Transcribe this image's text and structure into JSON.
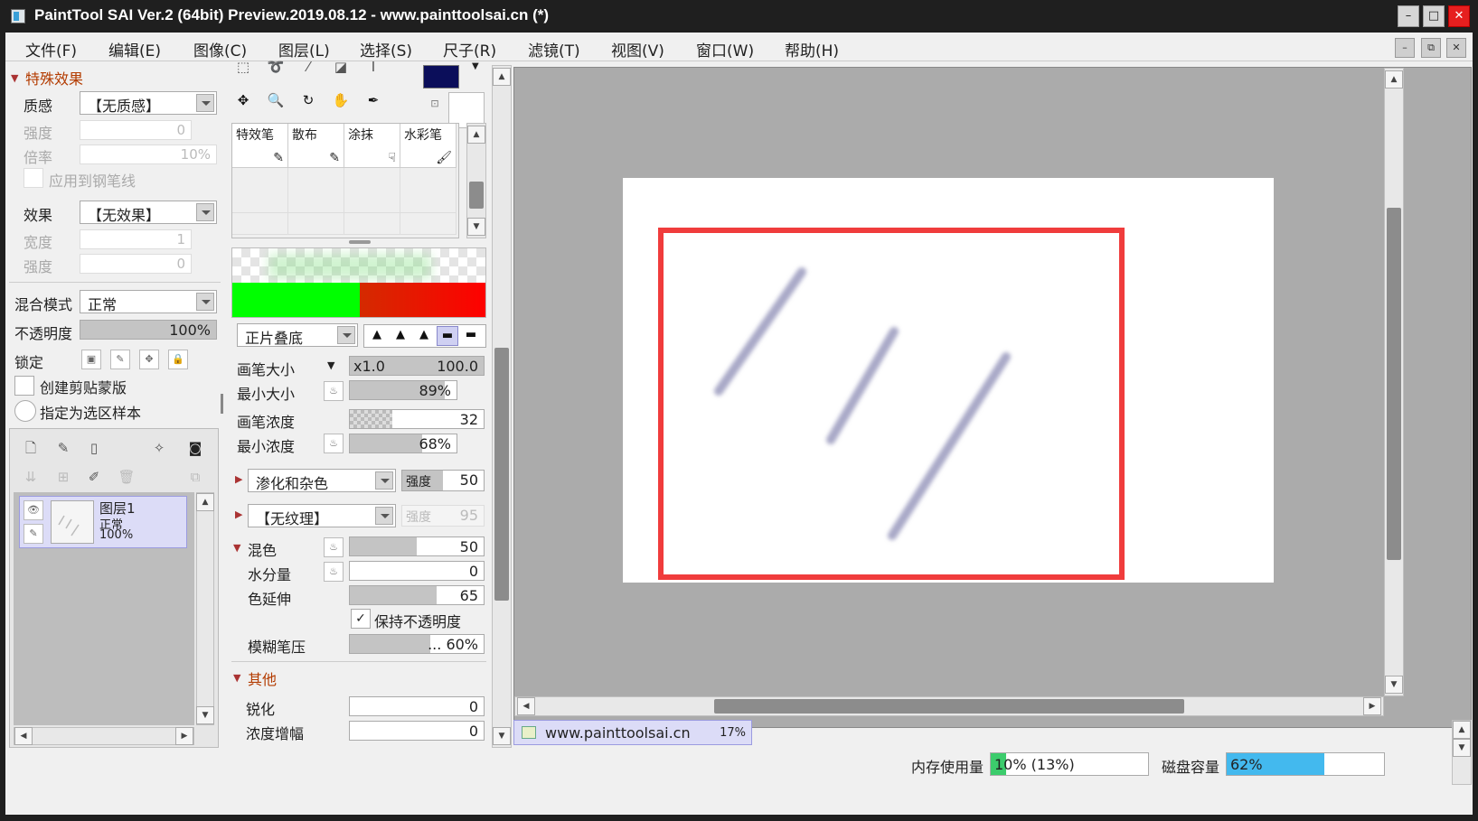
{
  "titlebar": {
    "title": "PaintTool SAI Ver.2 (64bit) Preview.2019.08.12 - www.painttoolsai.cn (*)",
    "minimize": "–",
    "maximize": "□",
    "close": "✕"
  },
  "menu": {
    "items": [
      "文件(F)",
      "编辑(E)",
      "图像(C)",
      "图层(L)",
      "选择(S)",
      "尺子(R)",
      "滤镜(T)",
      "视图(V)",
      "窗口(W)",
      "帮助(H)"
    ],
    "mdi_min": "–",
    "mdi_restore": "⧉",
    "mdi_close": "✕"
  },
  "effects": {
    "title": "特殊效果",
    "texture_label": "质感",
    "texture_value": "【无质感】",
    "strength_label": "强度",
    "strength_value": "0",
    "scale_label": "倍率",
    "scale_value": "10%",
    "apply_pen_label": "应用到钢笔线",
    "effect_label": "效果",
    "effect_value": "【无效果】",
    "width_label": "宽度",
    "width_value": "1",
    "strength2_label": "强度",
    "strength2_value": "0"
  },
  "layer_props": {
    "blend_label": "混合模式",
    "blend_value": "正常",
    "opacity_label": "不透明度",
    "opacity_value": "100%",
    "opacity_fraction": 1.0,
    "lock_label": "锁定",
    "clip_label": "创建剪贴蒙版",
    "sample_label": "指定为选区样本"
  },
  "layers": [
    {
      "name": "图层1",
      "mode": "正常",
      "opacity": "100%"
    }
  ],
  "brushes": {
    "cells": [
      {
        "label": "特效笔"
      },
      {
        "label": "散布"
      },
      {
        "label": "涂抹"
      },
      {
        "label": "水彩笔"
      }
    ]
  },
  "brush_settings": {
    "blend_mode": "正片叠底",
    "size_label": "画笔大小",
    "size_mult": "x1.0",
    "size_value": "100.0",
    "min_size_label": "最小大小",
    "min_size_value": "89%",
    "min_size_fraction": 0.89,
    "density_label": "画笔浓度",
    "density_value": "32",
    "min_density_label": "最小浓度",
    "min_density_value": "68%",
    "min_density_fraction": 0.68,
    "bleed_value": "渗化和杂色",
    "bleed_strength_label": "强度",
    "bleed_strength_value": "50",
    "texture_value": "【无纹理】",
    "texture_strength_label": "强度",
    "texture_strength_value": "95",
    "mix_label": "混色",
    "mix_value": "50",
    "mix_fraction": 0.5,
    "water_label": "水分量",
    "water_value": "0",
    "stretch_label": "色延伸",
    "stretch_value": "65",
    "stretch_fraction": 0.65,
    "keep_opacity_label": "保持不透明度",
    "blur_label": "模糊笔压",
    "blur_value": "... 60%",
    "blur_fraction": 0.6,
    "other_label": "其他",
    "sharpen_label": "锐化",
    "sharpen_value": "0",
    "amplify_label": "浓度增幅",
    "amplify_value": "0"
  },
  "colors": {
    "primary": "#0b0e5a",
    "accent_green": "#00ff00",
    "accent_red": "#ff0000",
    "frame_red": "#f03c3c",
    "stroke": "#a9a9c7"
  },
  "doc_tab": {
    "name": "www.painttoolsai.cn",
    "zoom": "17%"
  },
  "status": {
    "memory_label": "内存使用量",
    "memory_value": "10% (13%)",
    "memory_fraction": 0.1,
    "disk_label": "磁盘容量",
    "disk_value": "62%",
    "disk_fraction": 0.62
  }
}
